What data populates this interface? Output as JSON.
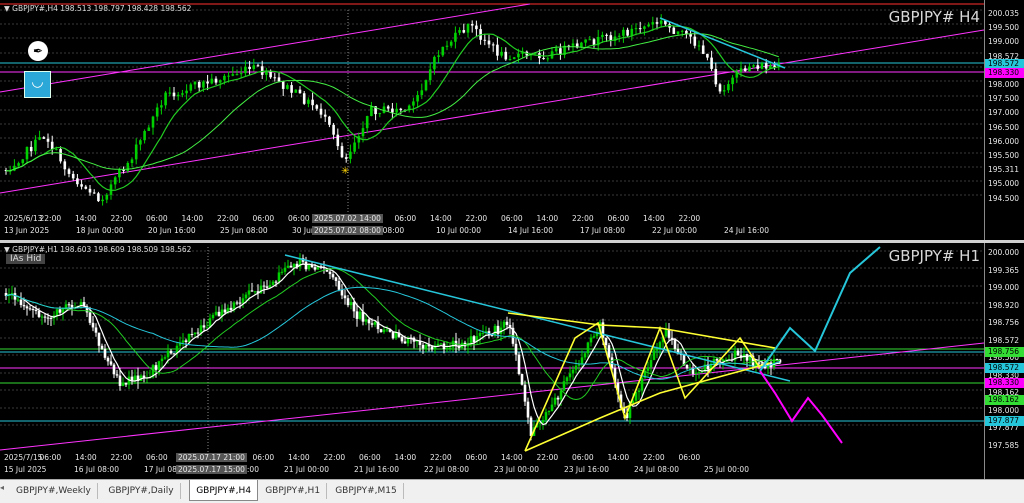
{
  "top_panel": {
    "header": "▼ GBPJPY#,H4  198.513 198.797 198.428 198.562",
    "symbol_label": "GBPJPY# H4",
    "price_ticks": [
      "200.035",
      "199.500",
      "199.000",
      "198.572",
      "198.330",
      "198.000",
      "197.500",
      "197.000",
      "196.500",
      "196.000",
      "195.500",
      "195.311",
      "195.000",
      "194.500"
    ],
    "badges": [
      {
        "text": "198.572",
        "color": "#26c6da"
      },
      {
        "text": "198.330",
        "color": "#ff00ff"
      }
    ],
    "time_labels": [
      "13 Jun 2025",
      "18 Jun 00:00",
      "20 Jun 16:00",
      "25 Jun 08:00",
      "30 Jun 0",
      "7 Jul 08:00",
      "10 Jul 00:00",
      "14 Jul 16:00",
      "17 Jul 08:00",
      "22 Jul 00:00",
      "24 Jul 16:00"
    ],
    "time_labels_upper": [
      "2025/6/13",
      "22:00",
      "14:00",
      "22:00",
      "06:00",
      "14:00",
      "22:00",
      "06:00",
      "06:00",
      "14:00",
      "22:00",
      "06:00",
      "14:00",
      "22:00",
      "06:00",
      "14:00",
      "22:00",
      "06:00",
      "14:00",
      "22:00"
    ],
    "crosshair_top": "2025.07.02 14:00",
    "crosshair_bottom": "2025.07.02 08:00"
  },
  "bottom_panel": {
    "header": "▼ GBPJPY#,H1  198.603 198.609 198.509 198.562",
    "hide_button": "IAs Hid",
    "symbol_label": "GBPJPY# H1",
    "price_ticks": [
      "200.000",
      "199.365",
      "199.000",
      "198.920",
      "198.756",
      "198.572",
      "198.500",
      "198.330",
      "198.162",
      "198.000",
      "197.877",
      "197.585"
    ],
    "badges": [
      {
        "text": "198.756",
        "color": "#33dd33"
      },
      {
        "text": "198.572",
        "color": "#26c6da"
      },
      {
        "text": "198.330",
        "color": "#ff00ff"
      },
      {
        "text": "198.162",
        "color": "#33dd33"
      },
      {
        "text": "197.877",
        "color": "#26c6da"
      }
    ],
    "time_labels": [
      "15 Jul 2025",
      "16 Jul 08:00",
      "17 Jul 08",
      "18 Jul 08:00",
      "21 Jul 00:00",
      "21 Jul 16:00",
      "22 Jul 08:00",
      "23 Jul 00:00",
      "23 Jul 16:00",
      "24 Jul 08:00",
      "25 Jul 00:00"
    ],
    "time_labels_upper": [
      "2025/7/15",
      "06:00",
      "14:00",
      "22:00",
      "06:00",
      "14:00",
      "22:00",
      "06:00",
      "14:00",
      "22:00",
      "06:00",
      "14:00",
      "22:00",
      "06:00",
      "14:00",
      "22:00",
      "06:00",
      "14:00",
      "22:00",
      "06:00"
    ],
    "crosshair_top": "2025.07.17 21:00",
    "crosshair_bottom": "2025.07.17 15:00"
  },
  "tabs": [
    {
      "label": "GBPJPY#,Weekly",
      "active": false
    },
    {
      "label": "GBPJPY#,Daily",
      "active": false
    },
    {
      "label": "GBPJPY#,H4",
      "active": true
    },
    {
      "label": "GBPJPY#,H1",
      "active": false
    },
    {
      "label": "GBPJPY#,M15",
      "active": false
    }
  ],
  "colors": {
    "up_candle": "#00d000",
    "down_candle": "#ffffff",
    "ma_green": "#22cc22",
    "ma_cyan": "#26c6da",
    "channel": "#ff33ff",
    "pattern": "#ffff33",
    "projection_up": "#26c6da",
    "projection_down": "#ff00ff"
  }
}
